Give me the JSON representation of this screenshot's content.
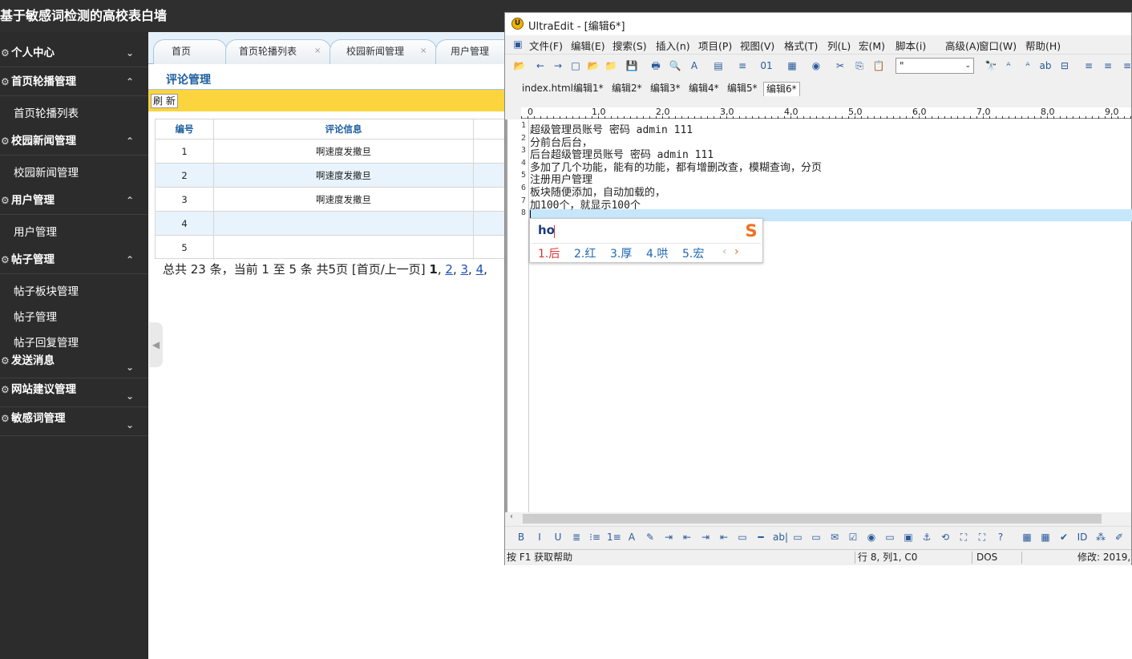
{
  "site": {
    "title": "基于敏感词检测的高校表白墙"
  },
  "sidebar": {
    "sections": [
      {
        "label": "个人中心",
        "chevron": "⌄"
      },
      {
        "label": "首页轮播管理",
        "chevron": "⌃",
        "items": [
          "首页轮播列表"
        ]
      },
      {
        "label": "校园新闻管理",
        "chevron": "⌃",
        "items": [
          "校园新闻管理"
        ]
      },
      {
        "label": "用户管理",
        "chevron": "⌃",
        "items": [
          "用户管理"
        ]
      },
      {
        "label": "帖子管理",
        "chevron": "⌃",
        "items": [
          "帖子板块管理",
          "帖子管理",
          "帖子回复管理"
        ]
      },
      {
        "label": "发送消息",
        "chevron": "⌄"
      },
      {
        "label": "网站建议管理",
        "chevron": "⌄"
      },
      {
        "label": "敏感词管理",
        "chevron": "⌄"
      }
    ],
    "gear_glyph": "⚙",
    "collapse_glyph": "◀"
  },
  "tabs": [
    "首页",
    "首页轮播列表",
    "校园新闻管理",
    "用户管理"
  ],
  "tab_close_glyph": "×",
  "page": {
    "title": "评论管理",
    "refresh_label": "刷 新",
    "columns": [
      "编号",
      "评论信息"
    ],
    "rows": [
      {
        "id": "1",
        "comment": "啊速度发撒旦"
      },
      {
        "id": "2",
        "comment": "啊速度发撒旦"
      },
      {
        "id": "3",
        "comment": "啊速度发撒旦"
      },
      {
        "id": "4",
        "comment": ""
      },
      {
        "id": "5",
        "comment": ""
      }
    ],
    "pager": {
      "summary": "总共 23 条，当前 1 至 5 条 共5页  [首页/上一页] ",
      "current": "1",
      "links": [
        "2",
        "3",
        "4"
      ],
      "sep": ","
    }
  },
  "editor": {
    "title": "UltraEdit - [编辑6*]",
    "menu": [
      "文件(F)",
      "编辑(E)",
      "搜索(S)",
      "插入(n)",
      "项目(P)",
      "视图(V)",
      "格式(T)",
      "列(L)",
      "宏(M)",
      "脚本(i)",
      "高级(A)",
      "窗口(W)",
      "帮助(H)"
    ],
    "toolbar_icons": [
      "open-icon",
      "back-icon",
      "forward-icon",
      "new-file-icon",
      "open-folder-icon",
      "folder-icon",
      "save-icon",
      "print-icon",
      "print-preview-icon",
      "spellcheck-icon",
      "page-icon",
      "wrap-icon",
      "hex-icon",
      "clipboard-list-icon",
      "browser-icon",
      "cut-icon",
      "copy-icon",
      "paste-icon",
      "find-icon",
      "find-next-icon",
      "replace-icon",
      "find-files-icon",
      "column-icon",
      "align-left-icon",
      "align-center-icon",
      "align-right-icon"
    ],
    "toolbar_glyphs": [
      "📂",
      "←",
      "→",
      "□",
      "📂",
      "📁",
      "💾",
      "🖶",
      "🔍",
      "A",
      "▤",
      "≡",
      "01",
      "▦",
      "◉",
      "✂",
      "⎘",
      "📋",
      "🔭",
      "ᴬ",
      "ᴬ",
      "ab",
      "⊟",
      "≡",
      "≡",
      "≡"
    ],
    "search_combo": "\"",
    "combo_arrow": "⌄",
    "file_tabs": [
      "index.html",
      "编辑1*",
      "编辑2*",
      "编辑3*",
      "编辑4*",
      "编辑5*",
      "编辑6*"
    ],
    "active_tab_index": 6,
    "ruler": [
      "0",
      "1,0",
      "2,0",
      "3,0",
      "4,0",
      "5,0",
      "6,0",
      "7,0",
      "8,0",
      "9,0"
    ],
    "lines": [
      "超级管理员账号  密码  admin 111",
      "分前台后台，",
      "后台超级管理员账号 密码  admin 111",
      "多加了几个功能，能有的功能，都有增删改查，模糊查询，分页",
      "注册用户管理",
      "板块随便添加，自动加载的，",
      "加100个，就显示100个",
      ""
    ],
    "bottom_toolbar": [
      "B",
      "I",
      "U",
      "≣",
      "⁝≡",
      "1≡",
      "A",
      "✎",
      "⇥",
      "⇤",
      "⇥",
      "⇤",
      "▭",
      "━",
      "ab|",
      "▭",
      "▭",
      "✉",
      "☑",
      "◉",
      "▭",
      "▣",
      "⚓",
      "⟲",
      "⛶",
      "⛶",
      "?",
      "▦",
      "▦",
      "✔",
      "ID",
      "⁂",
      "✐"
    ],
    "status": {
      "help": "按 F1 获取帮助",
      "position": "行 8, 列1, C0",
      "format": "DOS",
      "modified": "修改: 2019,"
    }
  },
  "ime": {
    "input": "ho",
    "candidates": [
      "1.后",
      "2.红",
      "3.厚",
      "4.哄",
      "5.宏"
    ],
    "logo": "S",
    "prev": "‹",
    "next": "›"
  },
  "colors": {
    "topbar": "#2f2f2f",
    "sidebar": "#2c2c2c",
    "accent_blue": "#1d5fa0",
    "yellow_bar": "#fcd43d",
    "current_line": "#c6e6fb",
    "ime_first": "#e03030"
  }
}
